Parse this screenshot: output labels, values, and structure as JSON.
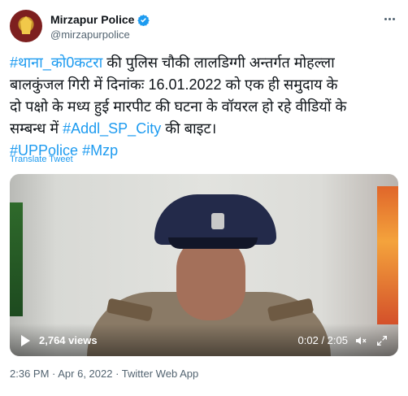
{
  "author": {
    "display_name": "Mirzapur Police",
    "handle": "@mirzapurpolice"
  },
  "tweet": {
    "lines": [
      [
        {
          "text": "#थाना_को0कटरा",
          "type": "hashtag"
        },
        {
          "text": " की पुलिस चौकी लालडिग्गी अन्तर्गत मोहल्ला",
          "type": "text"
        }
      ],
      [
        {
          "text": "बालकुंजल गिरी में दिनांकः 16.01.2022 को एक ही समुदाय के",
          "type": "text"
        }
      ],
      [
        {
          "text": "दो पक्षो के मध्य हुई मारपीट की घटना के वॉयरल हो रहे वीडियों के",
          "type": "text"
        }
      ],
      [
        {
          "text": "सम्बन्ध में ",
          "type": "text"
        },
        {
          "text": "#Addl_SP_City",
          "type": "hashtag"
        },
        {
          "text": " की बाइट।",
          "type": "text"
        }
      ],
      [
        {
          "text": "#UPPolice",
          "type": "hashtag"
        },
        {
          "text": " ",
          "type": "text"
        },
        {
          "text": "#Mzp",
          "type": "hashtag"
        }
      ]
    ],
    "translate_label": "Translate Tweet"
  },
  "video": {
    "views": "2,764 views",
    "time": "0:02 / 2:05"
  },
  "meta": "2:36 PM · Apr 6, 2022 · Twitter Web App",
  "colors": {
    "link": "#1d9bf0",
    "secondary_text": "#536471",
    "primary_text": "#0f1419"
  },
  "icons": [
    "avatar",
    "verified-badge-icon",
    "more-options-icon",
    "play-icon",
    "mute-icon",
    "fullscreen-icon"
  ]
}
